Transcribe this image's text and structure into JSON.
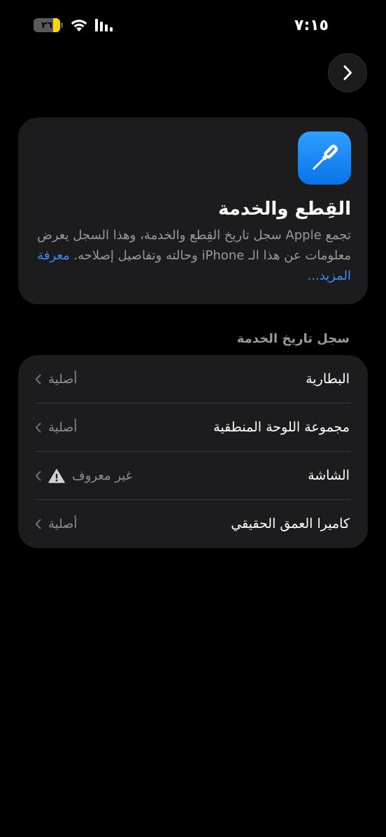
{
  "status_bar": {
    "time": "٧:١٥",
    "battery_level": "٢٦",
    "battery_fraction": 0.26
  },
  "colors": {
    "accent": "#3a8ef6",
    "battery": "#ffd60a",
    "card_bg": "#1c1c1e",
    "secondary_text": "#98989f"
  },
  "nav": {
    "forward_icon": "chevron-right-icon"
  },
  "info_card": {
    "icon": "screwdriver-icon",
    "title": "القِطع والخدمة",
    "description": "تجمع Apple سجل تاريخ القِطع والخدمة، وهذا السجل يعرض معلومات عن هذا الـ iPhone وحالته وتفاصيل إصلاحه.",
    "learn_more": "معرفة المزيد..."
  },
  "service_history": {
    "header": "سجل تاريخ الخدمة",
    "items": [
      {
        "label": "البطارية",
        "value": "أصلية",
        "warning": false
      },
      {
        "label": "مجموعة اللوحة المنطقية",
        "value": "أصلية",
        "warning": false
      },
      {
        "label": "الشاشة",
        "value": "غير معروف",
        "warning": true
      },
      {
        "label": "كاميرا العمق الحقيقي",
        "value": "أصلية",
        "warning": false
      }
    ]
  }
}
